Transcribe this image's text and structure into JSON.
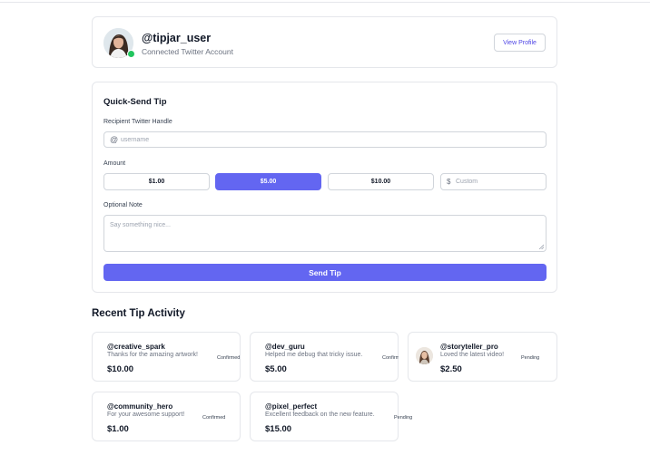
{
  "profile": {
    "handle": "@tipjar_user",
    "subtitle": "Connected Twitter Account",
    "view_profile_label": "View Profile",
    "online": true
  },
  "quick_send": {
    "title": "Quick-Send Tip",
    "recipient_label": "Recipient Twitter Handle",
    "recipient_prefix": "@",
    "recipient_placeholder": "username",
    "amount_label": "Amount",
    "amounts": [
      "$1.00",
      "$5.00",
      "$10.00"
    ],
    "selected_amount": "$5.00",
    "custom_prefix": "$",
    "custom_placeholder": "Custom",
    "note_label": "Optional Note",
    "note_placeholder": "Say something nice...",
    "send_label": "Send Tip"
  },
  "activity": {
    "title": "Recent Tip Activity",
    "tips": [
      {
        "handle": "@creative_spark",
        "message": "Thanks for the amazing artwork!",
        "amount": "$10.00",
        "status": "Confirmed"
      },
      {
        "handle": "@dev_guru",
        "message": "Helped me debug that tricky issue.",
        "amount": "$5.00",
        "status": "Confirmed"
      },
      {
        "handle": "@storyteller_pro",
        "message": "Loved the latest video!",
        "amount": "$2.50",
        "status": "Pending"
      },
      {
        "handle": "@community_hero",
        "message": "For your awesome support!",
        "amount": "$1.00",
        "status": "Confirmed"
      },
      {
        "handle": "@pixel_perfect",
        "message": "Excellent feedback on the new feature.",
        "amount": "$15.00",
        "status": "Pending"
      }
    ]
  },
  "colors": {
    "accent": "#6366f1",
    "online": "#22c55e",
    "link": "#4f46e5"
  }
}
